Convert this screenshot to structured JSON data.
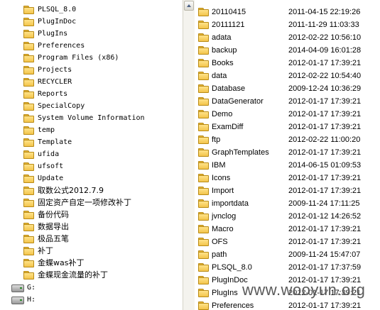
{
  "tree": {
    "folders": [
      "PLSQL_8.0",
      "PlugInDoc",
      "PlugIns",
      "Preferences",
      "Program Files (x86)",
      "Projects",
      "RECYCLER",
      "Reports",
      "SpecialCopy",
      "System Volume Information",
      "temp",
      "Template",
      "ufida",
      "ufsoft",
      "Update",
      "取数公式2012.7.9",
      "固定资产自定一项修改补丁",
      "备份代码",
      "数据导出",
      "极品五笔",
      "补丁",
      "金蝶was补丁",
      "金蝶现金流量的补丁"
    ],
    "drives": [
      "G:",
      "H:"
    ]
  },
  "files": [
    {
      "name": "20110415",
      "date": "2011-04-15 22:19:26"
    },
    {
      "name": "20111121",
      "date": "2011-11-29 11:03:33"
    },
    {
      "name": "adata",
      "date": "2012-02-22 10:56:10"
    },
    {
      "name": "backup",
      "date": "2014-04-09 16:01:28"
    },
    {
      "name": "Books",
      "date": "2012-01-17 17:39:21"
    },
    {
      "name": "data",
      "date": "2012-02-22 10:54:40"
    },
    {
      "name": "Database",
      "date": "2009-12-24 10:36:29"
    },
    {
      "name": "DataGenerator",
      "date": "2012-01-17 17:39:21"
    },
    {
      "name": "Demo",
      "date": "2012-01-17 17:39:21"
    },
    {
      "name": "ExamDiff",
      "date": "2012-01-17 17:39:21"
    },
    {
      "name": "ftp",
      "date": "2012-02-22 11:00:20"
    },
    {
      "name": "GraphTemplates",
      "date": "2012-01-17 17:39:21"
    },
    {
      "name": "IBM",
      "date": "2014-06-15 01:09:53"
    },
    {
      "name": "Icons",
      "date": "2012-01-17 17:39:21"
    },
    {
      "name": "Import",
      "date": "2012-01-17 17:39:21"
    },
    {
      "name": "importdata",
      "date": "2009-11-24 17:11:25"
    },
    {
      "name": "jvnclog",
      "date": "2012-01-12 14:26:52"
    },
    {
      "name": "Macro",
      "date": "2012-01-17 17:39:21"
    },
    {
      "name": "OFS",
      "date": "2012-01-17 17:39:21"
    },
    {
      "name": "path",
      "date": "2009-11-24 15:47:07"
    },
    {
      "name": "PLSQL_8.0",
      "date": "2012-01-17 17:37:59"
    },
    {
      "name": "PlugInDoc",
      "date": "2012-01-17 17:39:21"
    },
    {
      "name": "PlugIns",
      "date": "2012-01-17 17:39:21"
    },
    {
      "name": "Preferences",
      "date": "2012-01-17 17:39:21"
    }
  ],
  "watermark": "www.wooyun.org"
}
